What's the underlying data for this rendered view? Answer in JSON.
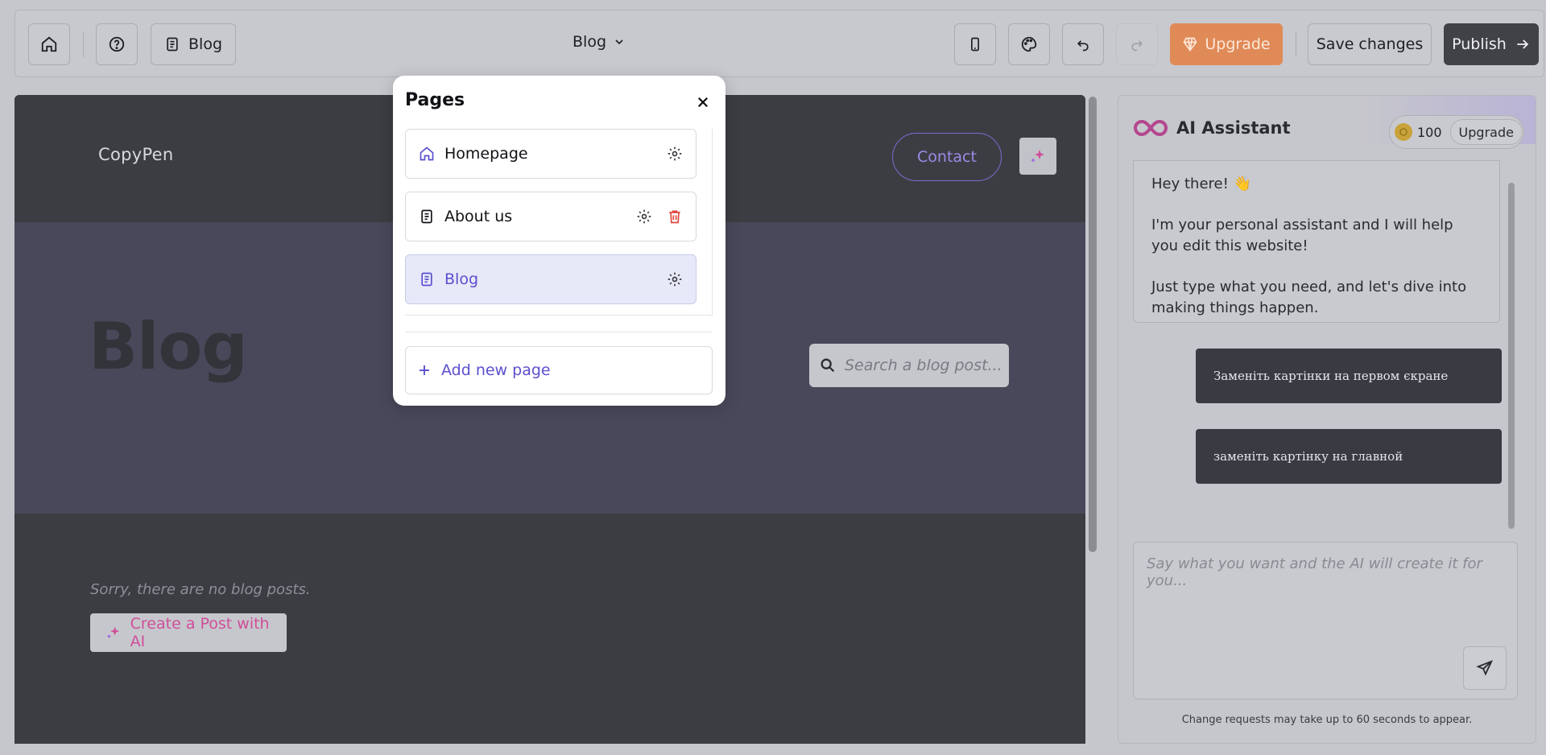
{
  "toolbar": {
    "home_icon": "home-icon",
    "help_icon": "help-circle-icon",
    "current_page_button": "Blog",
    "page_selector": "Blog",
    "upgrade_label": "Upgrade",
    "save_label": "Save changes",
    "publish_label": "Publish"
  },
  "preview": {
    "site_logo": "CopyPen",
    "contact_label": "Contact",
    "hero_title": "Blog",
    "search_placeholder": "Search a blog post...",
    "no_posts_text": "Sorry, there are no blog posts.",
    "create_post_label": "Create a Post with AI"
  },
  "ai_panel": {
    "title": "AI Assistant",
    "credits": "100",
    "upgrade_label": "Upgrade",
    "greeting": "Hey there! 👋",
    "intro": "I'm your personal assistant and I will help you edit this website!",
    "prompt": "Just type what you need, and let's dive into making things happen.",
    "user_messages": [
      "Заменіть картінки на первом єкране",
      "заменіть картінку на главной"
    ],
    "input_placeholder": "Say what you want and the AI will create it for you...",
    "note": "Change requests may take up to 60 seconds to appear."
  },
  "pages_modal": {
    "title": "Pages",
    "pages": [
      {
        "label": "Homepage",
        "icon": "home-icon"
      },
      {
        "label": "About us",
        "icon": "document-icon"
      },
      {
        "label": "Blog",
        "icon": "document-icon"
      }
    ],
    "add_label": "Add new page"
  },
  "colors": {
    "accent": "#5a4fcf",
    "upgrade": "#e08a57",
    "publish": "#414248",
    "danger": "#e0463c"
  }
}
